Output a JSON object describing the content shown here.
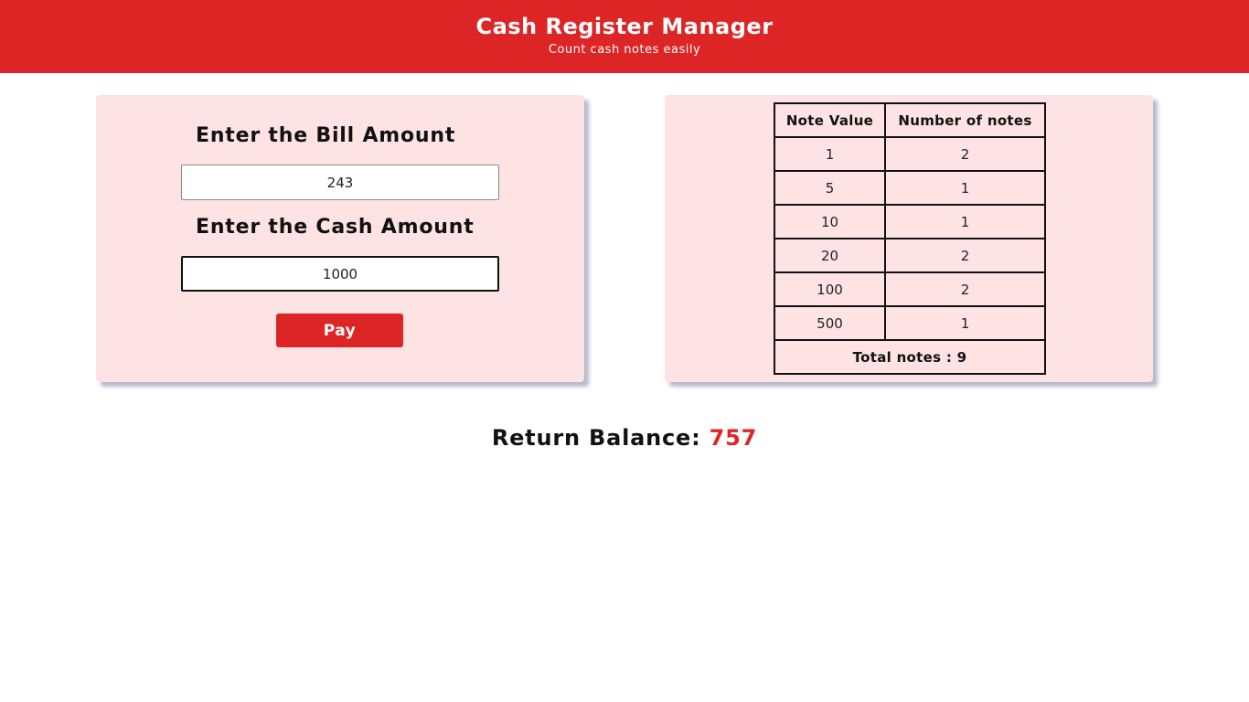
{
  "header": {
    "title": "Cash Register Manager",
    "subtitle": "Count cash notes easily"
  },
  "form": {
    "bill_label": "Enter the Bill Amount",
    "bill_value": "243",
    "cash_label": "Enter the Cash Amount",
    "cash_value": "1000",
    "pay_label": "Pay"
  },
  "notes_table": {
    "headers": [
      "Note Value",
      "Number of notes"
    ],
    "rows": [
      {
        "note": "1",
        "count": "2"
      },
      {
        "note": "5",
        "count": "1"
      },
      {
        "note": "10",
        "count": "1"
      },
      {
        "note": "20",
        "count": "2"
      },
      {
        "note": "100",
        "count": "2"
      },
      {
        "note": "500",
        "count": "1"
      }
    ],
    "total": "Total notes : 9"
  },
  "result": {
    "label": "Return Balance:",
    "amount": "757"
  },
  "colors": {
    "accent": "#de2526",
    "card_bg": "#fde3e3"
  }
}
